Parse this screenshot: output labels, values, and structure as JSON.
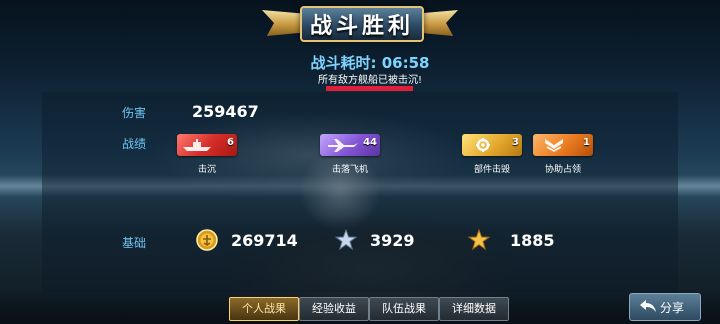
{
  "header": {
    "title": "战斗胜利"
  },
  "summary": {
    "duration_label": "战斗耗时: 06:58",
    "message": "所有敌方舰船已被击沉!"
  },
  "damage": {
    "label": "伤害",
    "value": "259467"
  },
  "achievements": {
    "label": "战绩",
    "items": [
      {
        "name": "击沉",
        "count": "6",
        "color": "#d62f2a",
        "icon": "ship-icon"
      },
      {
        "name": "击落飞机",
        "count": "44",
        "color": "#8254d4",
        "icon": "plane-icon"
      },
      {
        "name": "部件击毁",
        "count": "3",
        "color": "#e4a82e",
        "icon": "gear-icon"
      },
      {
        "name": "协助占领",
        "count": "1",
        "color": "#ea7a1f",
        "icon": "chevron-rank-icon"
      }
    ]
  },
  "base": {
    "label": "基础",
    "items": [
      {
        "icon": "gold-coin-icon",
        "value": "269714"
      },
      {
        "icon": "silver-star-icon",
        "value": "3929"
      },
      {
        "icon": "gold-star-icon",
        "value": "1885"
      }
    ]
  },
  "tabs": [
    {
      "label": "个人战果",
      "active": true
    },
    {
      "label": "经验收益",
      "active": false
    },
    {
      "label": "队伍战果",
      "active": false
    },
    {
      "label": "详细数据",
      "active": false
    }
  ],
  "share": {
    "label": "分享",
    "icon": "share-arrow-icon"
  }
}
